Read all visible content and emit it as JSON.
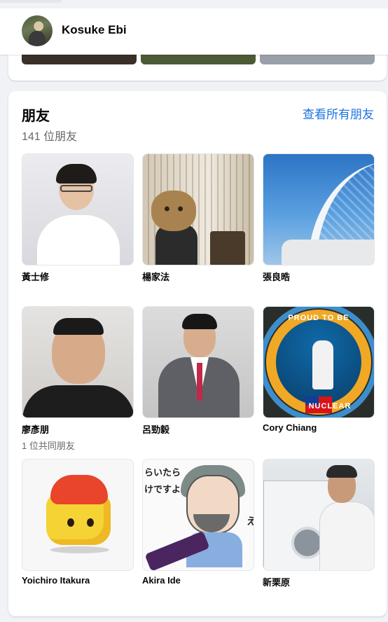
{
  "header": {
    "profile_name": "Kosuke Ebi"
  },
  "friends_section": {
    "title": "朋友",
    "count_text": "141 位朋友",
    "see_all_label": "查看所有朋友",
    "friends": [
      {
        "name": "黃士修",
        "mutual": ""
      },
      {
        "name": "楊家法",
        "mutual": ""
      },
      {
        "name": "張良晧",
        "mutual": ""
      },
      {
        "name": "廖彥朋",
        "mutual": "1 位共同朋友"
      },
      {
        "name": "呂勁毅",
        "mutual": ""
      },
      {
        "name": "Cory Chiang",
        "mutual": ""
      },
      {
        "name": "Yoichiro Itakura",
        "mutual": ""
      },
      {
        "name": "Akira Ide",
        "mutual": ""
      },
      {
        "name": "新栗原",
        "mutual": ""
      }
    ]
  },
  "photo_texts": {
    "ring_text": "PROUD TO BE",
    "ring_text_bottom": "NUCLEAR",
    "manga_text": "らいたら\nけですよ。",
    "manga_side": "え"
  },
  "colors": {
    "link": "#1b74e4",
    "secondary_text": "#65676b",
    "background": "#f0f2f5"
  }
}
